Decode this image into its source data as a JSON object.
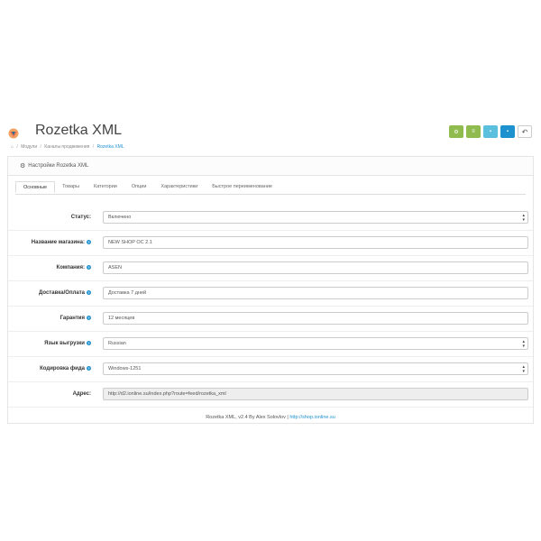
{
  "header": {
    "title": "Rozetka XML",
    "toolbar": [
      {
        "name": "settings-icon",
        "glyph": "⚙",
        "color": "#8fbb4f"
      },
      {
        "name": "list-icon",
        "glyph": "≡",
        "color": "#8fbb4f"
      },
      {
        "name": "save-icon",
        "glyph": "▪",
        "color": "#5bc0de"
      },
      {
        "name": "save-close-icon",
        "glyph": "▪",
        "color": "#1e91cf"
      },
      {
        "name": "back-icon",
        "glyph": "↶",
        "color": "#ffffff"
      }
    ]
  },
  "breadcrumb": {
    "home_icon": "home-icon",
    "items": [
      "Модули",
      "Каналы продвижения",
      "Rozetka XML"
    ]
  },
  "panel": {
    "heading": "Настройки Rozetka XML",
    "heading_icon": "gear-icon"
  },
  "tabs": [
    "Основные",
    "Товары",
    "Категории",
    "Опции",
    "Характеристики",
    "Быстрое переименование"
  ],
  "form": {
    "status": {
      "label": "Статус:",
      "value": "Включено"
    },
    "shop_name": {
      "label": "Название магазина:",
      "value": "NEW SHOP OC 2.1"
    },
    "company": {
      "label": "Компания:",
      "value": "ASEN"
    },
    "delivery": {
      "label": "Доставка/Оплата",
      "value": "Доставка 7 дней"
    },
    "warranty": {
      "label": "Гарантия",
      "value": "12 месяцев"
    },
    "language": {
      "label": "Язык выгрузки",
      "value": "Russian"
    },
    "encoding": {
      "label": "Кодировка фида",
      "value": "Windows-1251"
    },
    "address": {
      "label": "Адрес:",
      "value": "http://d2.ionline.su/index.php?route=feed/rozetka_xml"
    }
  },
  "footer": {
    "text": "Rozetka XML, v2.4 By Alex Solovlov",
    "separator": "|",
    "link": "http://shop.ionline.su"
  },
  "colors": {
    "accent": "#1e91cf",
    "green": "#8fbb4f",
    "cyan": "#5bc0de"
  }
}
